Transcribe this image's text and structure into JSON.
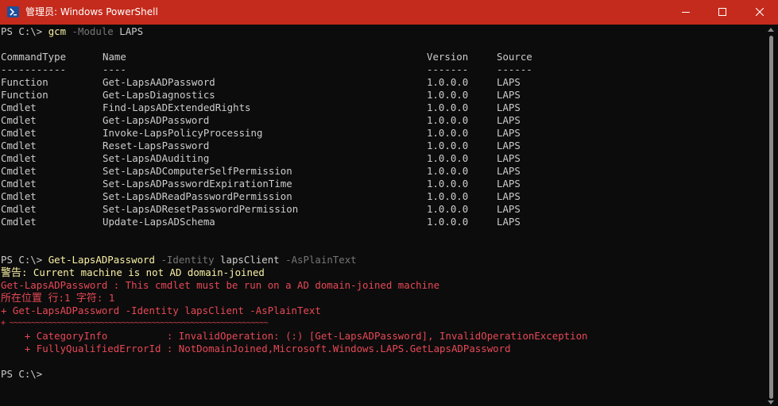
{
  "window": {
    "title": "管理员: Windows PowerShell",
    "controls": {
      "minimize_icon": "minimize-icon",
      "maximize_icon": "maximize-icon",
      "close_icon": "close-icon"
    },
    "titlebar_color": "#c42b1c",
    "background_color": "#0c0c0c"
  },
  "terminal": {
    "prompt": "PS C:\\>",
    "cmd1": {
      "name": "gcm",
      "param": "-Module",
      "arg": "LAPS"
    },
    "table": {
      "headers": {
        "type": "CommandType",
        "name": "Name",
        "version": "Version",
        "source": "Source"
      },
      "underlines": {
        "type": "-----------",
        "name": "----",
        "version": "-------",
        "source": "------"
      },
      "rows": [
        {
          "type": "Function",
          "name": "Get-LapsAADPassword",
          "version": "1.0.0.0",
          "source": "LAPS"
        },
        {
          "type": "Function",
          "name": "Get-LapsDiagnostics",
          "version": "1.0.0.0",
          "source": "LAPS"
        },
        {
          "type": "Cmdlet",
          "name": "Find-LapsADExtendedRights",
          "version": "1.0.0.0",
          "source": "LAPS"
        },
        {
          "type": "Cmdlet",
          "name": "Get-LapsADPassword",
          "version": "1.0.0.0",
          "source": "LAPS"
        },
        {
          "type": "Cmdlet",
          "name": "Invoke-LapsPolicyProcessing",
          "version": "1.0.0.0",
          "source": "LAPS"
        },
        {
          "type": "Cmdlet",
          "name": "Reset-LapsPassword",
          "version": "1.0.0.0",
          "source": "LAPS"
        },
        {
          "type": "Cmdlet",
          "name": "Set-LapsADAuditing",
          "version": "1.0.0.0",
          "source": "LAPS"
        },
        {
          "type": "Cmdlet",
          "name": "Set-LapsADComputerSelfPermission",
          "version": "1.0.0.0",
          "source": "LAPS"
        },
        {
          "type": "Cmdlet",
          "name": "Set-LapsADPasswordExpirationTime",
          "version": "1.0.0.0",
          "source": "LAPS"
        },
        {
          "type": "Cmdlet",
          "name": "Set-LapsADReadPasswordPermission",
          "version": "1.0.0.0",
          "source": "LAPS"
        },
        {
          "type": "Cmdlet",
          "name": "Set-LapsADResetPasswordPermission",
          "version": "1.0.0.0",
          "source": "LAPS"
        },
        {
          "type": "Cmdlet",
          "name": "Update-LapsADSchema",
          "version": "1.0.0.0",
          "source": "LAPS"
        }
      ]
    },
    "cmd2": {
      "name": "Get-LapsADPassword",
      "param1": "-Identity",
      "arg1": "lapsClient",
      "param2": "-AsPlainText"
    },
    "warning": "警告: Current machine is not AD domain-joined",
    "error_lines": [
      "Get-LapsADPassword : This cmdlet must be run on a AD domain-joined machine",
      "所在位置 行:1 字符: 1",
      "+ Get-LapsADPassword -Identity lapsClient -AsPlainText",
      "+ ~~~~~~~~~~~~~~~~~~~~~~~~~~~~~~~~~~~~~~~~~~~~~~~~~~~~~~~~~~~~",
      "    + CategoryInfo          : InvalidOperation: (:) [Get-LapsADPassword], InvalidOperationException",
      "    + FullyQualifiedErrorId : NotDomainJoined,Microsoft.Windows.LAPS.GetLapsADPassword"
    ],
    "colors": {
      "command": "#f9f1a5",
      "parameter": "#767676",
      "text": "#cccccc",
      "warning": "#f9f1a5",
      "error": "#e74856"
    }
  }
}
